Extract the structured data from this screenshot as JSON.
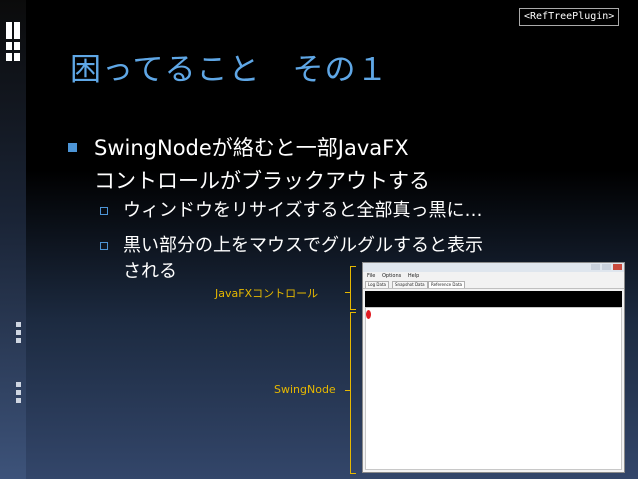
{
  "plugin_tag": "<RefTreePlugin>",
  "slide_title": "困ってること　その１",
  "bullet_main": {
    "line1": "SwingNodeが絡むと一部JavaFX",
    "line2": "コントロールがブラックアウトする"
  },
  "sub_bullets": [
    {
      "line1": "ウィンドウをリサイズすると全部真っ黒に…"
    },
    {
      "line1": "黒い部分の上をマウスでグルグルすると表示",
      "line2": "される"
    }
  ],
  "callouts": {
    "javafx_control": "JavaFXコントロール",
    "swing_node": "SwingNode"
  },
  "app_window": {
    "menu": [
      "File",
      "Options",
      "Help"
    ],
    "tabs": [
      "Log Data",
      "Snapshot Data",
      "Reference Data"
    ],
    "active_tab_index": 2
  },
  "colors": {
    "title": "#5fa7e6",
    "bullet_marker": "#4d95d6",
    "callout": "#e6b800",
    "blackout": "#000000",
    "cursor_marker": "#e11b22"
  }
}
